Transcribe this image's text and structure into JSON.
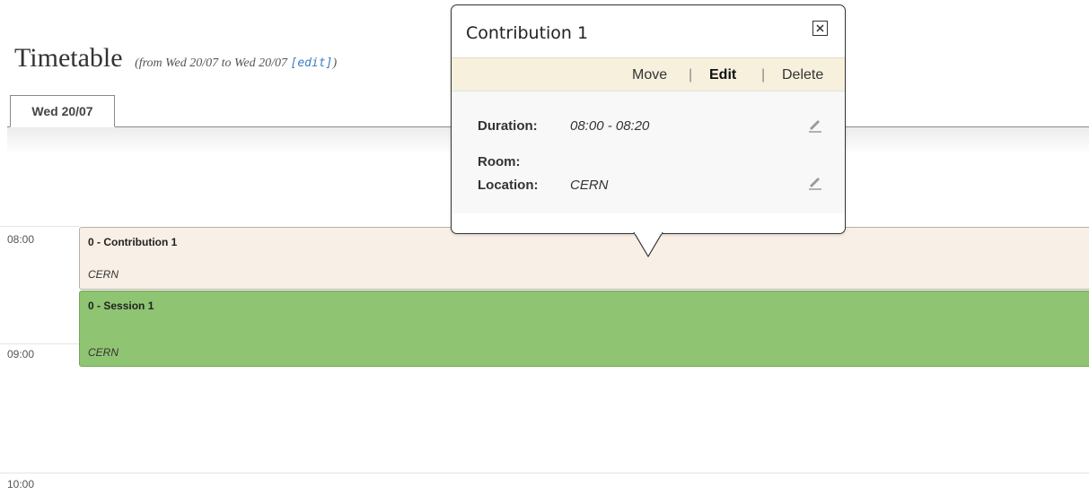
{
  "page": {
    "title": "Timetable",
    "range_prefix": "(from Wed 20/07 to Wed 20/07 ",
    "edit_link": "[edit]",
    "range_suffix": ")"
  },
  "tabs": [
    {
      "label": "Wed 20/07"
    }
  ],
  "timeline": {
    "hours": [
      "08:00",
      "09:00",
      "10:00"
    ]
  },
  "entries": {
    "contribution": {
      "title": "0 - Contribution 1",
      "location": "CERN",
      "color": "#f8efe6"
    },
    "session": {
      "title": "0 - Session 1",
      "location": "CERN",
      "color": "#8fc472"
    }
  },
  "balloon": {
    "title": "Contribution 1",
    "actions": {
      "move": "Move",
      "edit": "Edit",
      "delete": "Delete",
      "separator": "|"
    },
    "fields": {
      "duration_label": "Duration:",
      "duration_value": "08:00 - 08:20",
      "room_label": "Room:",
      "location_label": "Location:",
      "location_value": "CERN"
    },
    "icons": {
      "close": "close-icon",
      "edit": "pencil-icon"
    }
  }
}
